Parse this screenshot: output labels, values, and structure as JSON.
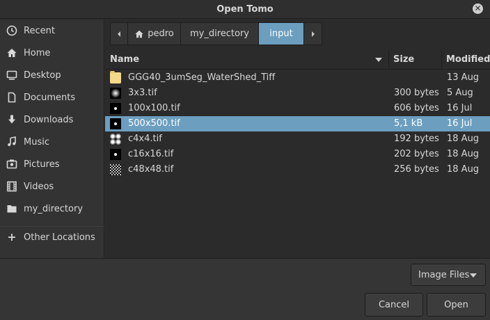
{
  "window": {
    "title": "Open Tomo",
    "close_icon": "close-icon"
  },
  "sidebar": {
    "items": [
      {
        "label": "Recent",
        "icon": "clock-icon"
      },
      {
        "label": "Home",
        "icon": "home-icon"
      },
      {
        "label": "Desktop",
        "icon": "desktop-icon"
      },
      {
        "label": "Documents",
        "icon": "documents-icon"
      },
      {
        "label": "Downloads",
        "icon": "download-icon"
      },
      {
        "label": "Music",
        "icon": "music-icon"
      },
      {
        "label": "Pictures",
        "icon": "pictures-icon"
      },
      {
        "label": "Videos",
        "icon": "videos-icon"
      },
      {
        "label": "my_directory",
        "icon": "folder-icon"
      },
      {
        "label": "Other Locations",
        "icon": "plus-icon"
      }
    ]
  },
  "pathbar": {
    "segments": [
      {
        "label": "pedro",
        "icon": "home-icon"
      },
      {
        "label": "my_directory"
      },
      {
        "label": "input",
        "active": true
      }
    ]
  },
  "columns": {
    "name": "Name",
    "size": "Size",
    "modified": "Modified"
  },
  "files": [
    {
      "name": "GGG40_3umSeg_WaterShed_Tiff",
      "size": "",
      "modified": "13 Aug",
      "icon": "folder-icon"
    },
    {
      "name": "3x3.tif",
      "size": "300 bytes",
      "modified": "5 Aug",
      "icon": "image-thumbnail-icon"
    },
    {
      "name": "100x100.tif",
      "size": "606 bytes",
      "modified": "16 Jul",
      "icon": "image-thumbnail-icon"
    },
    {
      "name": "500x500.tif",
      "size": "5,1 kB",
      "modified": "16 Jul",
      "icon": "image-thumbnail-icon",
      "selected": true
    },
    {
      "name": "c4x4.tif",
      "size": "192 bytes",
      "modified": "18 Aug",
      "icon": "image-thumbnail-icon"
    },
    {
      "name": "c16x16.tif",
      "size": "202 bytes",
      "modified": "18 Aug",
      "icon": "image-thumbnail-icon"
    },
    {
      "name": "c48x48.tif",
      "size": "256 bytes",
      "modified": "18 Aug",
      "icon": "image-thumbnail-icon"
    }
  ],
  "filter": {
    "label": "Image Files"
  },
  "buttons": {
    "cancel": "Cancel",
    "open": "Open"
  },
  "colors": {
    "accent": "#6b9ebf",
    "background": "#2b2b2b",
    "sidebar": "#333333"
  }
}
